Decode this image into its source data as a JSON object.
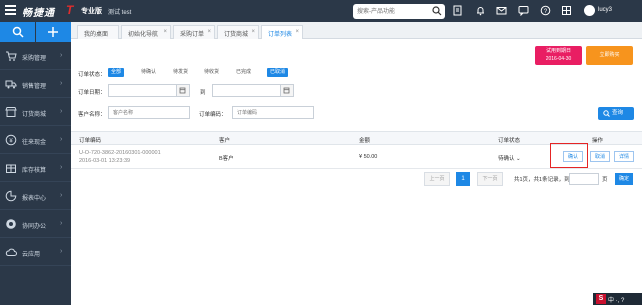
{
  "topbar": {
    "logo": "畅捷通",
    "edition": "专业版",
    "shop": "测试 test",
    "search_placeholder": "搜索-产品功能",
    "user": "lucy3"
  },
  "sidebar": {
    "items": [
      {
        "label": "采购管理",
        "icon": "cart-icon"
      },
      {
        "label": "销售管理",
        "icon": "truck-icon"
      },
      {
        "label": "订货商城",
        "icon": "store-icon"
      },
      {
        "label": "往来现金",
        "icon": "money-icon"
      },
      {
        "label": "库存核算",
        "icon": "warehouse-icon"
      },
      {
        "label": "报表中心",
        "icon": "chart-icon"
      },
      {
        "label": "协同办公",
        "icon": "office-icon"
      },
      {
        "label": "云应用",
        "icon": "cloud-icon"
      }
    ]
  },
  "tabs": [
    {
      "label": "我的桌面"
    },
    {
      "label": "初始化导航"
    },
    {
      "label": "采购订单"
    },
    {
      "label": "订货商城"
    },
    {
      "label": "订单列表"
    }
  ],
  "promo": {
    "expire_line1": "试用到期日",
    "expire_line2": "2016-04-30",
    "buy": "立即购买"
  },
  "filters": {
    "status_label": "订单状态：",
    "status_options": [
      "全部",
      "待确认",
      "待发货",
      "待收货",
      "已完成",
      "已取消"
    ],
    "date_label": "订单日期：",
    "date_sep": "到",
    "customer_label": "客户名称：",
    "customer_placeholder": "客户名称",
    "code_label": "订单编码：",
    "code_placeholder": "订单编码",
    "query": "查询"
  },
  "table": {
    "headers": [
      "订单编码",
      "客户",
      "金额",
      "订单状态",
      "操作"
    ],
    "row": {
      "code": "U-O-720-3862-20160301-000001",
      "time": "2016-03-01 13:23:39",
      "customer": "B客户",
      "amount": "¥ 50.00",
      "status": "待确认",
      "actions": [
        "确认",
        "取消",
        "详情"
      ]
    }
  },
  "pager": {
    "prev": "上一页",
    "current": "1",
    "next": "下一页",
    "info": "共1页，共1条记录，到第",
    "unit": "页",
    "go": "确定"
  },
  "tray": {
    "text": "中 ·, ?"
  },
  "colors": {
    "accent": "#1e88e5",
    "sidebar": "#2b3848",
    "expire": "#e91e63",
    "buy": "#f7941d",
    "highlight": "#e52525"
  }
}
